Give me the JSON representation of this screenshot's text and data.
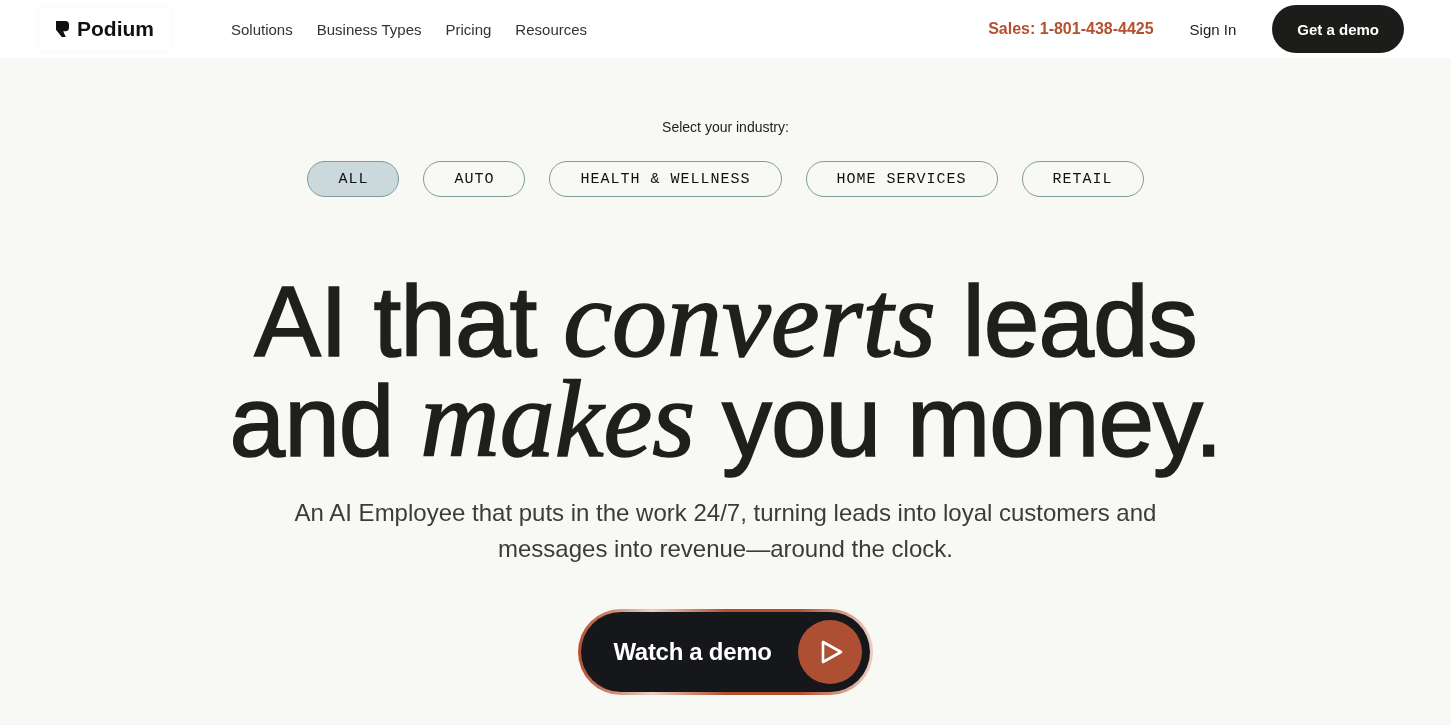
{
  "nav": {
    "logo": "Podium",
    "links": [
      "Solutions",
      "Business Types",
      "Pricing",
      "Resources"
    ],
    "sales": "Sales: 1-801-438-4425",
    "sign_in": "Sign In",
    "cta": "Get a demo"
  },
  "industry": {
    "prompt": "Select your industry:",
    "options": [
      {
        "label": "ALL",
        "selected": true
      },
      {
        "label": "AUTO",
        "selected": false
      },
      {
        "label": "HEALTH & WELLNESS",
        "selected": false
      },
      {
        "label": "HOME SERVICES",
        "selected": false
      },
      {
        "label": "RETAIL",
        "selected": false
      }
    ]
  },
  "hero": {
    "headline": [
      "AI that *converts* leads",
      "and *makes* you money."
    ],
    "subtitle": "An AI Employee that puts in the work 24/7, turning leads into loyal customers and messages into revenue—around the clock.",
    "button": "Watch a demo"
  }
}
